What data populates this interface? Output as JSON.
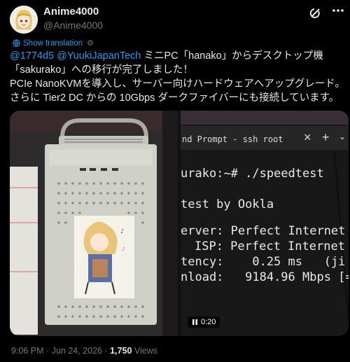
{
  "author": {
    "name": "Anime4000",
    "handle": "@Anime4000"
  },
  "translate": {
    "label": "Show translation"
  },
  "tweet": {
    "mention1": "@1774d5",
    "mention2": "@YuukiJapanTech",
    "line1_rest": " ミニPC「hanako」からデスクトップ機",
    "line2": "「sakurako」への移行が完了しました！",
    "line3": "PCIe NanoKVMを導入し、サーバー向けハードウェアへアップグレード。",
    "line4": "さらに Tier2 DC からの 10Gbps ダークファイバーにも接続しています。"
  },
  "terminal": {
    "tab_title": "nd Prompt - ssh root",
    "prompt": "urako:~# ./speedtest",
    "header": "test by Ookla",
    "server": "erver: Perfect Internet",
    "isp": "ISP: Perfect Internet",
    "latency": "tency:    0.25 ms   (ji",
    "download": "nload:   9184.96 Mbps [=="
  },
  "video": {
    "duration": "0:20"
  },
  "footer": {
    "time": "9:06 PM",
    "date": "Jun 24, 2026",
    "views": "1,750",
    "views_label": "Views"
  },
  "colors": {
    "accent": "#1d9bf0",
    "muted": "#71767b",
    "text": "#e7e9ea"
  }
}
